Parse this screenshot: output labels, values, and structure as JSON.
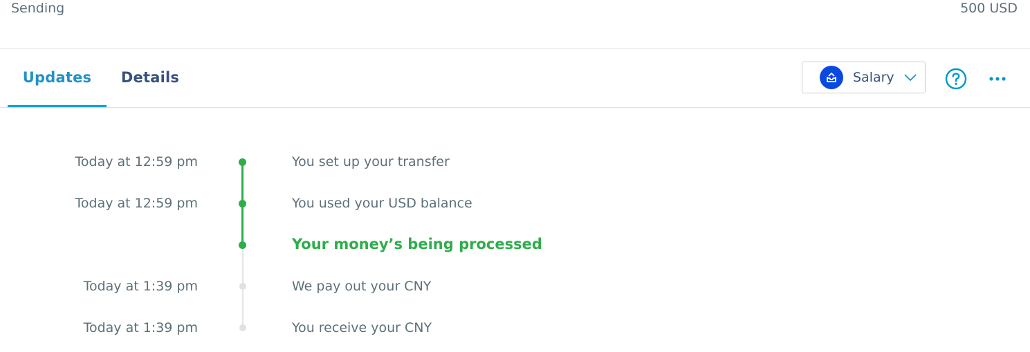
{
  "summary": {
    "label": "Sending",
    "amount": "500 USD"
  },
  "tabs": [
    {
      "label": "Updates",
      "active": true
    },
    {
      "label": "Details",
      "active": false
    }
  ],
  "category": {
    "label": "Salary",
    "icon": "inbox-tray-icon",
    "icon_color": "#0a49e1"
  },
  "actions": {
    "help_icon": "question-circle-icon",
    "more_icon": "more-dots-icon"
  },
  "colors": {
    "accent": "#00a2dd",
    "success": "#2ead4b",
    "pending": "#dfe1e3"
  },
  "timeline": [
    {
      "time": "Today at 12:59 pm",
      "text": "You set up your transfer",
      "status": "done"
    },
    {
      "time": "Today at 12:59 pm",
      "text": "You used your USD balance",
      "status": "done"
    },
    {
      "time": "",
      "text": "Your money’s being processed",
      "status": "current"
    },
    {
      "time": "Today at 1:39 pm",
      "text": "We pay out your CNY",
      "status": "pending"
    },
    {
      "time": "Today at 1:39 pm",
      "text": "You receive your CNY",
      "status": "pending"
    }
  ]
}
